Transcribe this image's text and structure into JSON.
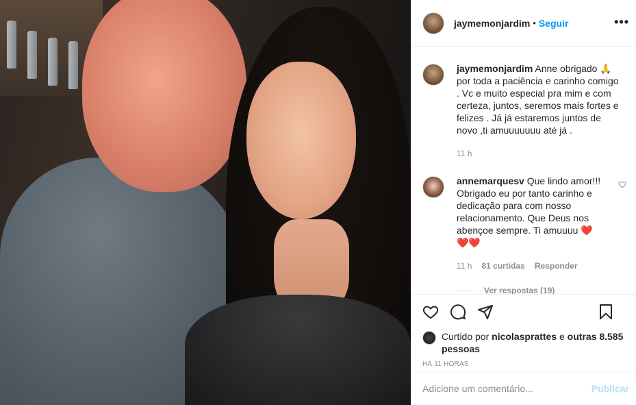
{
  "post": {
    "author": "jaymemonjardim",
    "separator": "•",
    "follow_label": "Seguir",
    "more_icon": "more-horizontal-icon",
    "more_label": "•••"
  },
  "caption": {
    "username": "jaymemonjardim",
    "text": "Anne obrigado 🙏 por toda a paciência e carinho comigo . Vc e muito especial pra mim e com certeza, juntos, seremos mais fortes e felizes . Já já estaremos juntos de novo ,ti amuuuuuuu até já .",
    "time": "11 h"
  },
  "comments": [
    {
      "username": "annemarquesv",
      "text": "Que lindo amor!!! Obrigado eu por tanto carinho e dedicação para com nosso relacionamento. Que Deus nos abençoe sempre. Ti amuuuu ❤️",
      "hearts": "❤️❤️",
      "time": "11 h",
      "likes": "81 curtidas",
      "reply_label": "Responder",
      "view_replies": "Ver respostas (19)"
    }
  ],
  "likes": {
    "prefix": "Curtido por",
    "user": "nicolasprattes",
    "connector": "e",
    "others": "outras 8.585 pessoas"
  },
  "timestamp": "HÁ 11 HORAS",
  "add_comment": {
    "placeholder": "Adicione um comentário...",
    "publish_label": "Publicar"
  },
  "colors": {
    "accent": "#0095f6",
    "publish_disabled": "#b2dffc",
    "heart": "#ed4956",
    "muted": "#8e8e8e"
  }
}
